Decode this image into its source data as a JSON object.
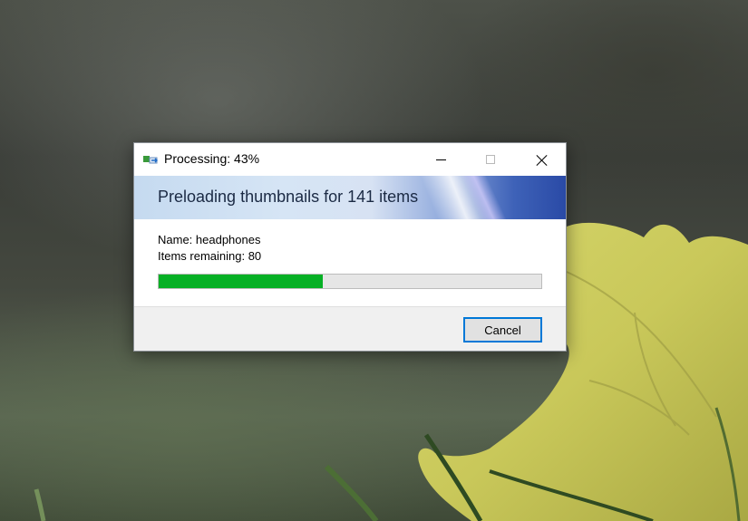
{
  "window": {
    "title": "Processing: 43%",
    "app_icon": "file-copy-icon",
    "controls": {
      "minimize": "minimize-icon",
      "maximize": "maximize-icon",
      "close": "close-icon"
    }
  },
  "banner": {
    "heading": "Preloading thumbnails for 141 items"
  },
  "details": {
    "name_line": "Name: headphones",
    "remaining_line": "Items remaining: 80"
  },
  "progress": {
    "percent": 43,
    "color": "#06b025"
  },
  "footer": {
    "cancel_label": "Cancel"
  },
  "colors": {
    "accent": "#0078d7",
    "progress_fill": "#06b025"
  }
}
